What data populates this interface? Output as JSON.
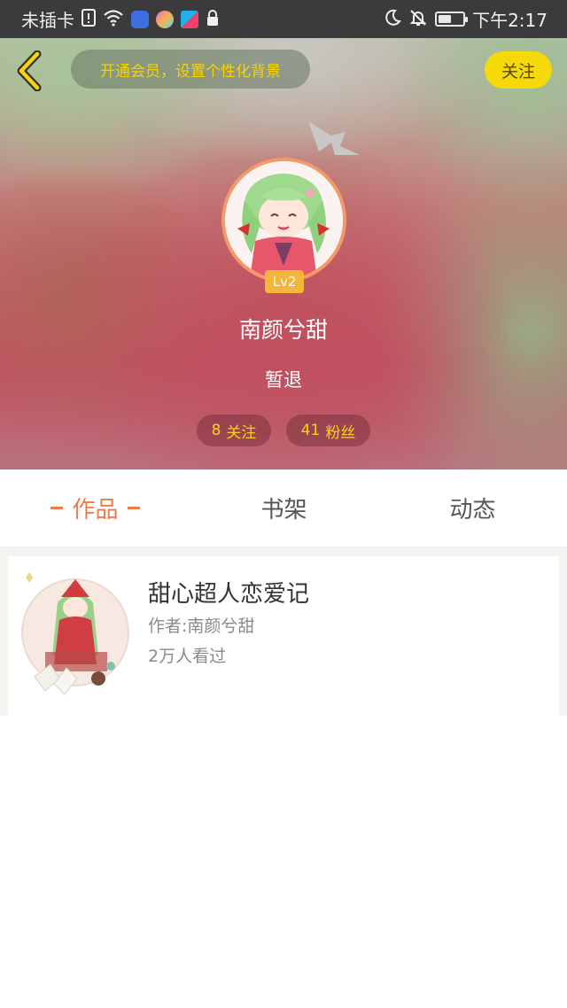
{
  "status_bar": {
    "carrier": "未插卡",
    "time": "下午2:17",
    "icons": [
      "sim-alert-icon",
      "wifi-icon",
      "baidu-app-icon",
      "app-icon",
      "app-icon",
      "lock-icon",
      "moon-icon",
      "bell-off-icon",
      "battery-icon"
    ],
    "battery_level": 0.55
  },
  "header": {
    "vip_prompt": "开通会员，设置个性化背景",
    "follow_label": "关注",
    "level": "Lv2",
    "username": "南颜兮甜",
    "bio": "暂退",
    "stats": {
      "following_count": "8",
      "following_label": "关注",
      "fans_count": "41",
      "fans_label": "粉丝"
    }
  },
  "tabs": [
    {
      "label": "作品",
      "active": true
    },
    {
      "label": "书架",
      "active": false
    },
    {
      "label": "动态",
      "active": false
    }
  ],
  "works": [
    {
      "title": "甜心超人恋爱记",
      "author_prefix": "作者: ",
      "author": "南颜兮甜",
      "views": "2万人看过"
    }
  ],
  "colors": {
    "accent": "#ef7a4a",
    "follow_yellow": "#f6d90b",
    "stat_text": "#f7d21a",
    "level_badge": "#f3b53a"
  }
}
